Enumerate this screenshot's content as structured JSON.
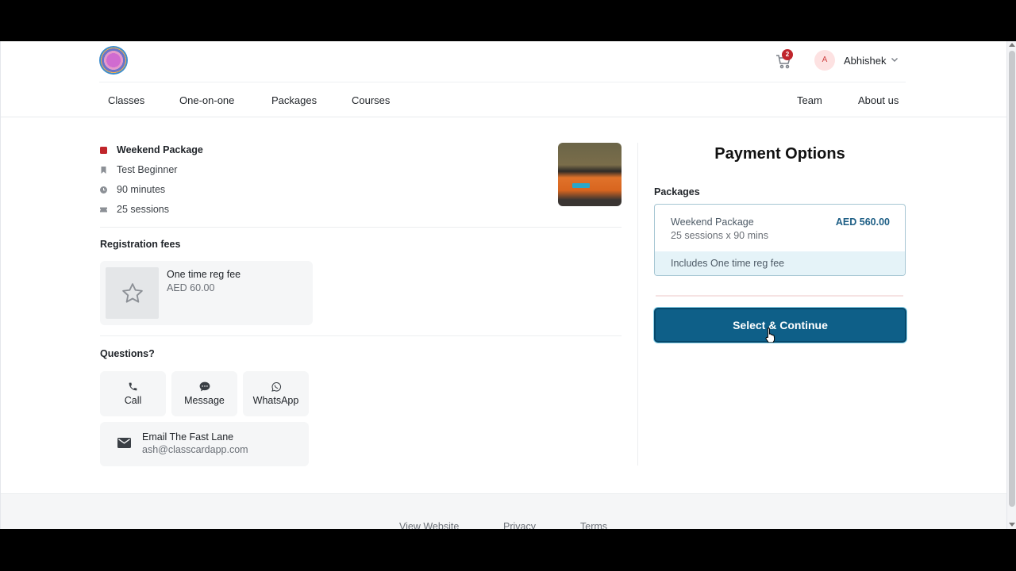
{
  "header": {
    "cart_count": "2",
    "avatar_initial": "A",
    "user_name": "Abhishek"
  },
  "nav": {
    "left": [
      "Classes",
      "One-on-one",
      "Packages",
      "Courses"
    ],
    "right": [
      "Team",
      "About us"
    ]
  },
  "details": {
    "package_name": "Weekend Package",
    "level": "Test Beginner",
    "duration": "90 minutes",
    "sessions": "25 sessions"
  },
  "registration": {
    "title": "Registration fees",
    "fee_name": "One time reg fee",
    "fee_price": "AED 60.00"
  },
  "questions": {
    "title": "Questions?",
    "call": "Call",
    "message": "Message",
    "whatsapp": "WhatsApp",
    "email_label": "Email The Fast Lane",
    "email_address": "ash@classcardapp.com"
  },
  "payment": {
    "title": "Payment Options",
    "packages_label": "Packages",
    "package_name": "Weekend Package",
    "package_price": "AED 560.00",
    "package_detail": "25 sessions x 90 mins",
    "includes": "Includes One time reg fee",
    "cta": "Select & Continue"
  },
  "footer": {
    "links": [
      "View Website",
      "Privacy",
      "Terms"
    ]
  },
  "colors": {
    "accent": "#0e5f88",
    "badge": "#c0252b",
    "package_highlight": "#e5f3f8"
  }
}
